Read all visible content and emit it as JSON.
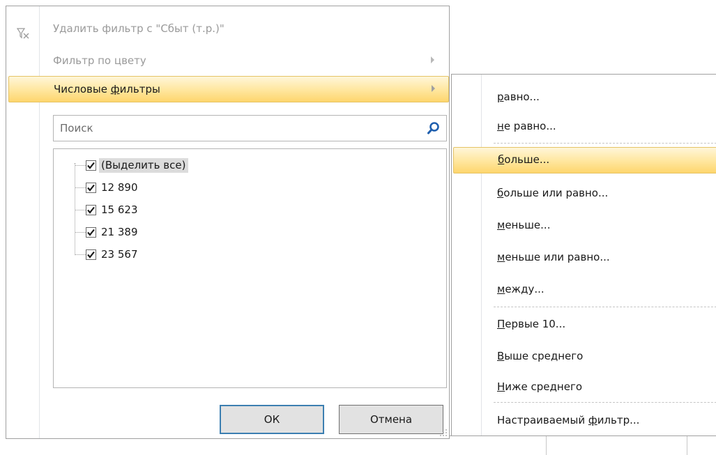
{
  "filter_panel": {
    "clear_filter_label": "Удалить фильтр с \"Сбыт (т.р.)\"",
    "filter_by_color_label": "Фильтр по цвету",
    "number_filters_label_pre": "Числовые ",
    "number_filters_label_accel": "ф",
    "number_filters_label_post": "ильтры",
    "search_placeholder": "Поиск",
    "items": [
      {
        "label": "(Выделить все)",
        "checked": true
      },
      {
        "label": "12 890",
        "checked": true
      },
      {
        "label": "15 623",
        "checked": true
      },
      {
        "label": "21 389",
        "checked": true
      },
      {
        "label": "23 567",
        "checked": true
      }
    ],
    "ok_label": "ОК",
    "cancel_label": "Отмена"
  },
  "submenu": {
    "items": [
      {
        "accel": "р",
        "rest": "авно..."
      },
      {
        "accel": "н",
        "rest": "е равно..."
      },
      {
        "accel": "б",
        "rest": "ольше..."
      },
      {
        "accel": "б",
        "rest": "ольше или равно..."
      },
      {
        "accel": "м",
        "rest": "еньше..."
      },
      {
        "accel": "м",
        "rest": "еньше или равно..."
      },
      {
        "accel": "м",
        "rest": "ежду..."
      },
      {
        "accel": "П",
        "rest": "ервые 10..."
      },
      {
        "accel": "В",
        "rest": "ыше среднего"
      },
      {
        "accel": "Н",
        "rest": "иже среднего"
      },
      {
        "pre": "Настраиваемый ",
        "accel": "ф",
        "rest": "ильтр..."
      }
    ],
    "highlighted_index": 2
  },
  "colors": {
    "highlight_top": "#fff6d9",
    "highlight_bottom": "#fed66d",
    "highlight_border": "#e5c365",
    "ok_button_border": "#3c7fb1",
    "search_icon": "#1f5fae"
  }
}
